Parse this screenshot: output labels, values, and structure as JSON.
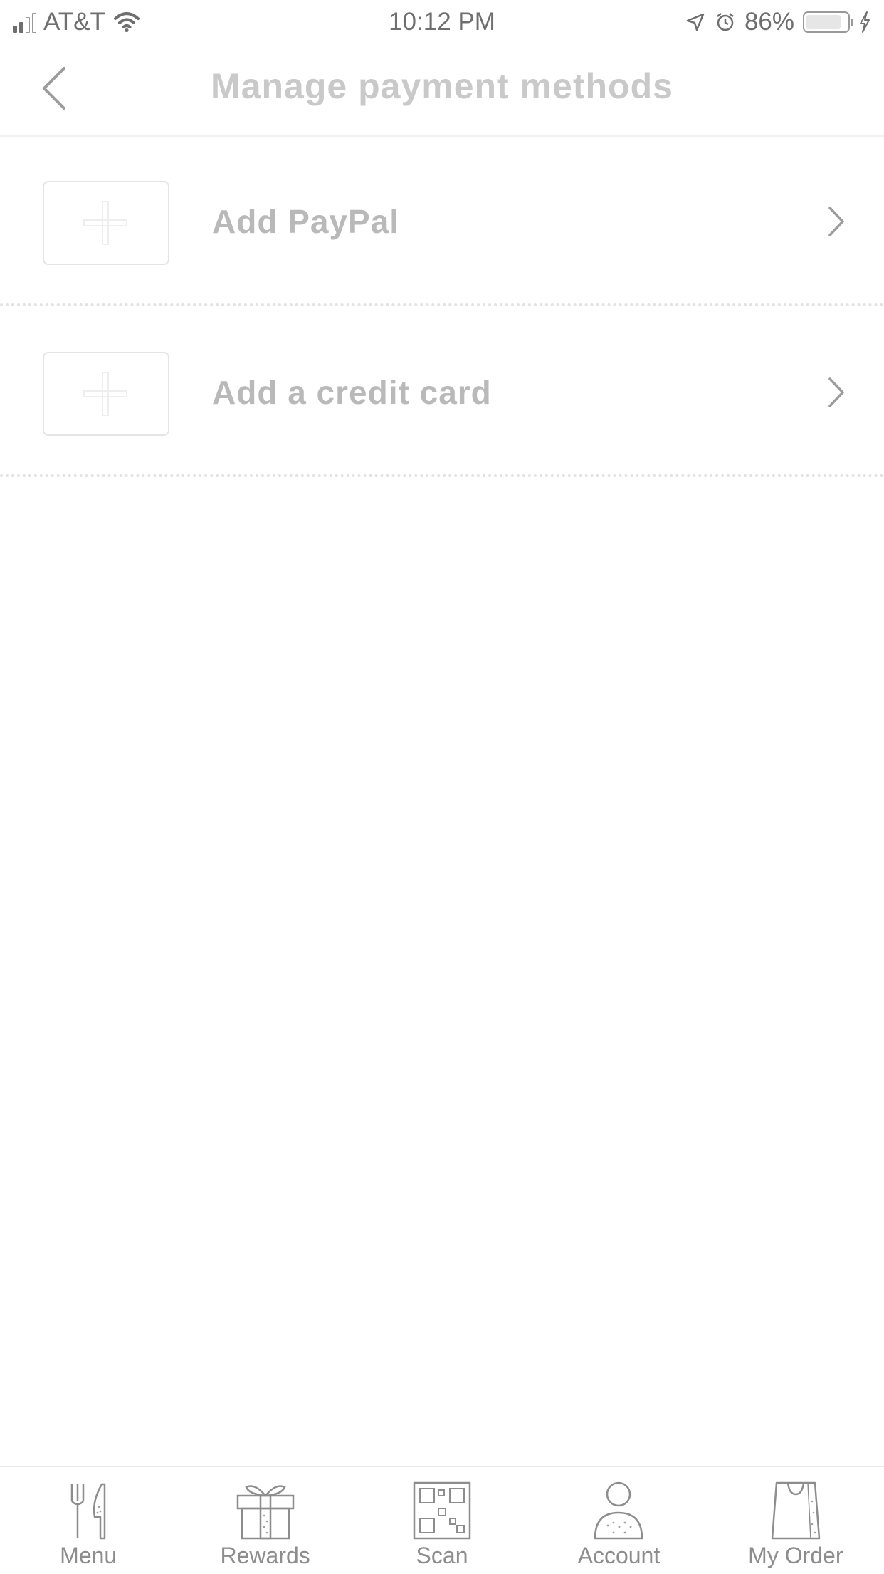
{
  "status_bar": {
    "carrier": "AT&T",
    "time": "10:12 PM",
    "battery_percent": "86%",
    "battery_level": 0.86
  },
  "header": {
    "title": "Manage payment methods",
    "back_icon": "chevron-left-icon"
  },
  "payment_rows": [
    {
      "label": "Add PayPal",
      "icon": "plus-icon",
      "chevron": "chevron-right-icon"
    },
    {
      "label": "Add a credit card",
      "icon": "plus-icon",
      "chevron": "chevron-right-icon"
    }
  ],
  "tab_bar": {
    "tabs": [
      {
        "label": "Menu",
        "icon": "fork-knife-icon"
      },
      {
        "label": "Rewards",
        "icon": "gift-icon"
      },
      {
        "label": "Scan",
        "icon": "qr-code-icon"
      },
      {
        "label": "Account",
        "icon": "person-icon"
      },
      {
        "label": "My Order",
        "icon": "bag-icon"
      }
    ]
  },
  "colors": {
    "title_text": "#c9c9c9",
    "row_text": "#b9b9b9",
    "tab_text": "#8d8d8d",
    "divider": "#e2e2e2"
  }
}
